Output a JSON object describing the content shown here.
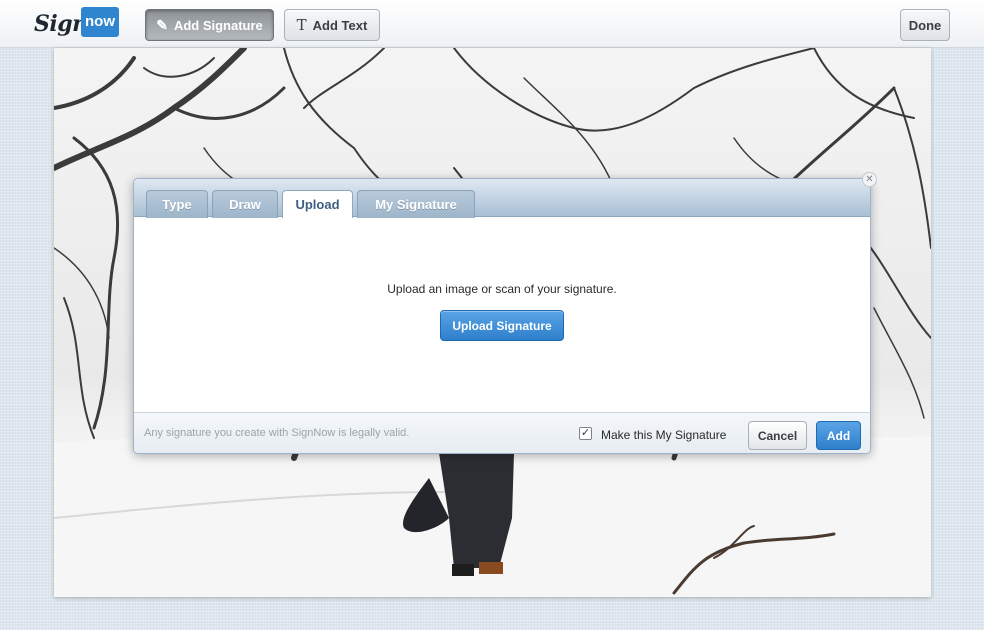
{
  "app": {
    "logo_sign": "Sign",
    "logo_now": "now"
  },
  "toolbar": {
    "add_signature_label": "Add Signature",
    "add_signature_icon": "pen-icon",
    "add_text_label": "Add Text",
    "add_text_icon": "text-t-icon",
    "done_label": "Done"
  },
  "dialog": {
    "tabs": [
      {
        "label": "Type"
      },
      {
        "label": "Draw"
      },
      {
        "label": "Upload",
        "active": true
      },
      {
        "label": "My Signature"
      }
    ],
    "instructions": "Upload an image or scan of your signature.",
    "upload_button": "Upload Signature",
    "legal_text": "Any signature you create with SignNow is legally valid.",
    "make_my_signature_label": "Make this My Signature",
    "make_my_signature_checked": true,
    "cancel_label": "Cancel",
    "add_label": "Add",
    "close_icon": "close-icon"
  },
  "colors": {
    "brand_blue": "#2f86cf",
    "tab_bar": "#a9bfd4",
    "primary_button": "#2e7fcb"
  }
}
